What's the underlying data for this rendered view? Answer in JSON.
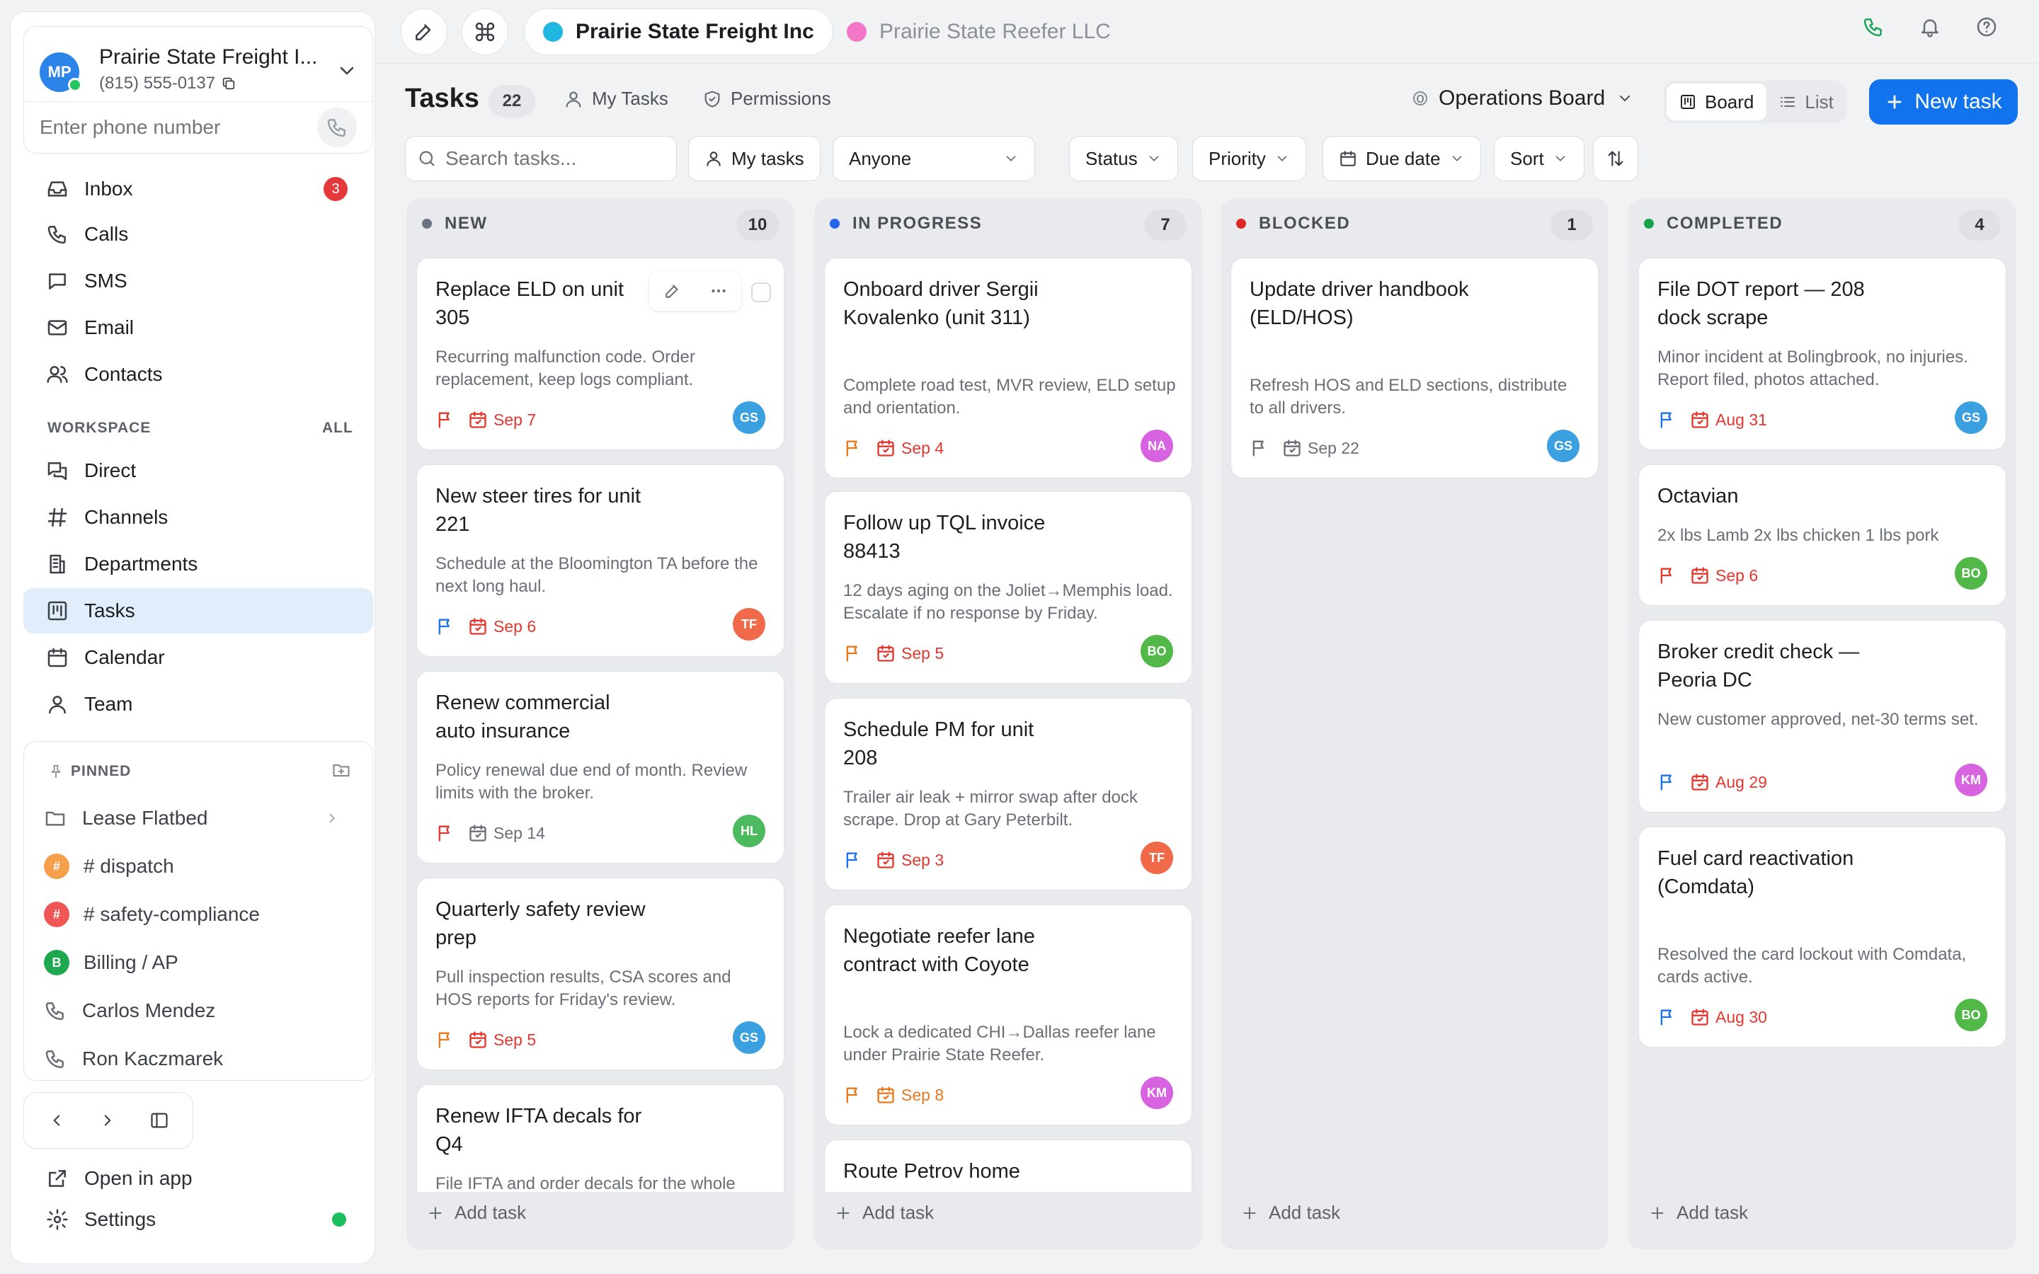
{
  "account": {
    "initials": "MP",
    "name": "Prairie State Freight I...",
    "phone": "(815) 555-0137",
    "phone_placeholder": "Enter phone number"
  },
  "nav": [
    {
      "label": "Inbox",
      "badge": "3"
    },
    {
      "label": "Calls"
    },
    {
      "label": "SMS"
    },
    {
      "label": "Email"
    },
    {
      "label": "Contacts"
    }
  ],
  "workspace": {
    "label": "WORKSPACE",
    "all": "ALL",
    "items": [
      "Direct",
      "Channels",
      "Departments",
      "Tasks",
      "Calendar",
      "Team"
    ],
    "active": "Tasks"
  },
  "pinned": {
    "label": "PINNED",
    "items": [
      {
        "label": "Lease Flatbed",
        "kind": "folder"
      },
      {
        "label": "# dispatch",
        "kind": "channel",
        "color": "#f59e4b",
        "glyph": "#"
      },
      {
        "label": "# safety-compliance",
        "kind": "channel",
        "color": "#f05656",
        "glyph": "#"
      },
      {
        "label": "Billing / AP",
        "kind": "channel",
        "color": "#1fa84f",
        "glyph": "B"
      },
      {
        "label": "Carlos Mendez",
        "kind": "phone"
      },
      {
        "label": "Ron Kaczmarek",
        "kind": "phone"
      }
    ]
  },
  "bottom": {
    "open_in_app": "Open in app",
    "settings": "Settings"
  },
  "tabs": [
    {
      "label": "Prairie State Freight Inc",
      "color": "#1fb6e0",
      "active": true
    },
    {
      "label": "Prairie State Reefer LLC",
      "color": "#f277c6",
      "active": false
    }
  ],
  "header": {
    "title": "Tasks",
    "count": "22",
    "my_tasks": "My Tasks",
    "permissions": "Permissions",
    "board_glyph": "o",
    "board": "Operations Board",
    "view_board": "Board",
    "view_list": "List",
    "new_task": "New task"
  },
  "filters": {
    "search_placeholder": "Search tasks...",
    "my_tasks": "My tasks",
    "anyone": "Anyone",
    "status": "Status",
    "priority": "Priority",
    "due_date": "Due date",
    "sort": "Sort"
  },
  "colors": {
    "red": "#e2372f",
    "orange": "#e8791f",
    "blue": "#1a73e8",
    "gray": "#6a6f77"
  },
  "columns": [
    {
      "title": "NEW",
      "count": "10",
      "dot": "#6b7280",
      "cards": [
        {
          "title": "Replace ELD on unit 305",
          "desc": "Recurring malfunction code. Order replacement, keep logs compliant.",
          "flag": "red",
          "date": "Sep 7",
          "date_color": "red",
          "avatar": "GS",
          "avatar_color": "#3aa0e0"
        },
        {
          "title": "New steer tires for unit 221",
          "desc": "Schedule at the Bloomington TA before the next long haul.",
          "flag": "blue",
          "date": "Sep 6",
          "date_color": "red",
          "avatar": "TF",
          "avatar_color": "#f06a4a"
        },
        {
          "title": "Renew commercial auto insurance",
          "desc": "Policy renewal due end of month. Review limits with the broker.",
          "flag": "red",
          "date": "Sep 14",
          "date_color": "gray",
          "avatar": "HL",
          "avatar_color": "#4cba5e"
        },
        {
          "title": "Quarterly safety review prep",
          "desc": "Pull inspection results, CSA scores and HOS reports for Friday's review.",
          "flag": "orange",
          "date": "Sep 5",
          "date_color": "red",
          "avatar": "GS",
          "avatar_color": "#3aa0e0"
        },
        {
          "title": "Renew IFTA decals for Q4",
          "desc": "File IFTA and order decals for the whole fleet.",
          "flag": "red",
          "date": "",
          "date_color": "gray",
          "avatar": "",
          "avatar_color": "#3aa0e0"
        }
      ]
    },
    {
      "title": "IN PROGRESS",
      "count": "7",
      "dot": "#2563eb",
      "cards": [
        {
          "title": "Onboard driver Sergii Kovalenko (unit 311)",
          "desc": "Complete road test, MVR review, ELD setup and orientation.",
          "flag": "orange",
          "date": "Sep 4",
          "date_color": "red",
          "avatar": "NA",
          "avatar_color": "#d863e0"
        },
        {
          "title": "Follow up TQL invoice 88413",
          "desc": "12 days aging on the Joliet→Memphis load. Escalate if no response by Friday.",
          "flag": "orange",
          "date": "Sep 5",
          "date_color": "red",
          "avatar": "BO",
          "avatar_color": "#52b848"
        },
        {
          "title": "Schedule PM for unit 208",
          "desc": "Trailer air leak + mirror swap after dock scrape. Drop at Gary Peterbilt.",
          "flag": "blue",
          "date": "Sep 3",
          "date_color": "red",
          "avatar": "TF",
          "avatar_color": "#f06a4a"
        },
        {
          "title": "Negotiate reefer lane contract with Coyote",
          "desc": "Lock a dedicated CHI→Dallas reefer lane under Prairie State Reefer.",
          "flag": "orange",
          "date": "Sep 8",
          "date_color": "orange",
          "avatar": "KM",
          "avatar_color": "#d863e0"
        },
        {
          "title": "Route Petrov home",
          "desc": "",
          "flag": "orange",
          "date": "",
          "date_color": "gray",
          "avatar": "",
          "avatar_color": "#3aa0e0"
        }
      ]
    },
    {
      "title": "BLOCKED",
      "count": "1",
      "dot": "#dc2626",
      "cards": [
        {
          "title": "Update driver handbook (ELD/HOS)",
          "desc": "Refresh HOS and ELD sections, distribute to all drivers.",
          "flag": "gray",
          "date": "Sep 22",
          "date_color": "gray",
          "avatar": "GS",
          "avatar_color": "#3aa0e0"
        }
      ]
    },
    {
      "title": "COMPLETED",
      "count": "4",
      "dot": "#16a34a",
      "cards": [
        {
          "title": "File DOT report — 208 dock scrape",
          "desc": "Minor incident at Bolingbrook, no injuries. Report filed, photos attached.",
          "flag": "blue",
          "date": "Aug 31",
          "date_color": "red",
          "avatar": "GS",
          "avatar_color": "#3aa0e0"
        },
        {
          "title": "Octavian",
          "desc": "2x lbs Lamb 2x lbs chicken 1 lbs pork",
          "flag": "red",
          "date": "Sep 6",
          "date_color": "red",
          "avatar": "BO",
          "avatar_color": "#52b848"
        },
        {
          "title": "Broker credit check — Peoria DC",
          "desc": "New customer approved, net-30 terms set.",
          "flag": "blue",
          "date": "Aug 29",
          "date_color": "red",
          "avatar": "KM",
          "avatar_color": "#d863e0"
        },
        {
          "title": "Fuel card reactivation (Comdata)",
          "desc": "Resolved the card lockout with Comdata, cards active.",
          "flag": "blue",
          "date": "Aug 30",
          "date_color": "red",
          "avatar": "BO",
          "avatar_color": "#52b848"
        }
      ]
    }
  ],
  "add_task": "Add task"
}
